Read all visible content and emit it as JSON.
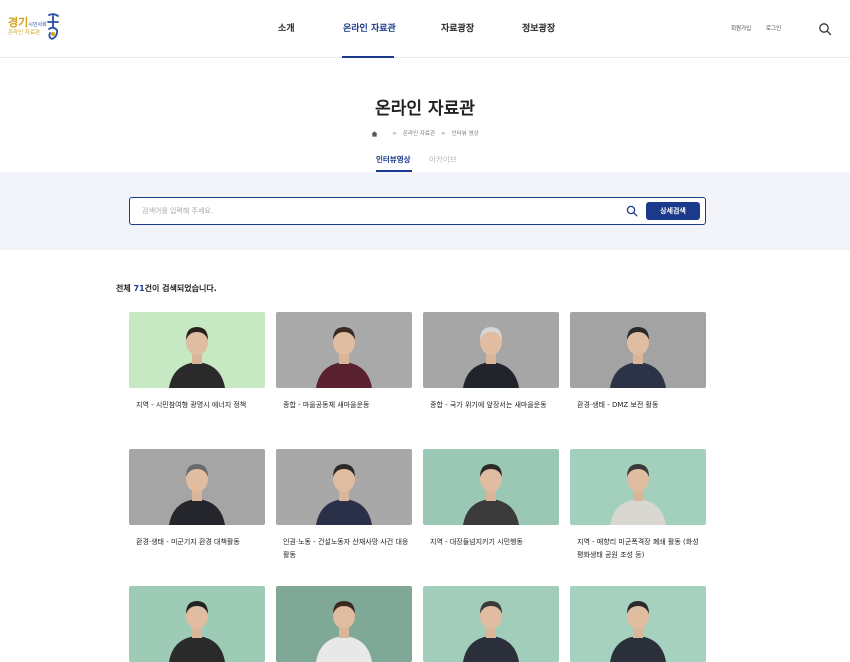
{
  "header": {
    "logo": {
      "main": "경기",
      "small": "시민사회",
      "sub": "온라인 자료관"
    },
    "nav": [
      {
        "label": "소개",
        "active": false
      },
      {
        "label": "온라인 자료관",
        "active": true
      },
      {
        "label": "자료광장",
        "active": false
      },
      {
        "label": "정보광장",
        "active": false
      }
    ],
    "util": {
      "signup": "회원가입",
      "login": "로그인"
    },
    "search_icon": "search-icon"
  },
  "page": {
    "title": "온라인 자료관",
    "breadcrumb": [
      "온라인 자료관",
      "인터뷰 영상"
    ],
    "subtabs": [
      {
        "label": "인터뷰영상",
        "active": true
      },
      {
        "label": "아카이브",
        "active": false
      }
    ]
  },
  "search": {
    "placeholder": "검색어를 입력해 주세요.",
    "value": "",
    "button": "상세검색"
  },
  "results": {
    "prefix": "전체 ",
    "count": "71",
    "suffix": "건이 검색되었습니다."
  },
  "cards": [
    {
      "title": "지역 - 시민참여형 광명시 에너지 정책",
      "bg": "#c6e8c2",
      "clothes": "#2a2a2a",
      "hair": "#2a221c"
    },
    {
      "title": "종합 - 마을공동체 새마을운동",
      "bg": "#a9a9a9",
      "clothes": "#5a2230",
      "hair": "#3a2a22"
    },
    {
      "title": "종합 - 국가 위기에 앞장서는 새마을운동",
      "bg": "#a6a6a6",
      "clothes": "#22242c",
      "hair": "#d6d6d6"
    },
    {
      "title": "환경·생태 - DMZ 보전 활동",
      "bg": "#a3a3a3",
      "clothes": "#2c3346",
      "hair": "#2a2a2a"
    },
    {
      "title": "환경·생태 - 미군기지 환경 대책활동",
      "bg": "#a5a5a5",
      "clothes": "#24262c",
      "hair": "#6a6a6a"
    },
    {
      "title": "인권·노동 - 건설노동자 산재사망 사건 대응 활동",
      "bg": "#a8a8a8",
      "clothes": "#2a3048",
      "hair": "#2a2a2a"
    },
    {
      "title": "지역 - 대장들넘지키기 시민행동",
      "bg": "#9bc8b4",
      "clothes": "#3a3a3a",
      "hair": "#2a2a2a"
    },
    {
      "title": "지역 - 매향리 미군폭격장 폐쇄 활동 (화성 평화생태 공원 조성 등)",
      "bg": "#a3cfbd",
      "clothes": "#d8d8d0",
      "hair": "#3a3a3a"
    },
    {
      "title": "",
      "bg": "#9ecbb5",
      "clothes": "#2a2a2a",
      "hair": "#222222"
    },
    {
      "title": "",
      "bg": "#7fa896",
      "clothes": "#e8e8e8",
      "hair": "#3a2a22"
    },
    {
      "title": "",
      "bg": "#a3cdbb",
      "clothes": "#2a2f3a",
      "hair": "#3a3a3a"
    },
    {
      "title": "",
      "bg": "#a6d1bf",
      "clothes": "#2a2f3a",
      "hair": "#2a2a2a"
    }
  ]
}
